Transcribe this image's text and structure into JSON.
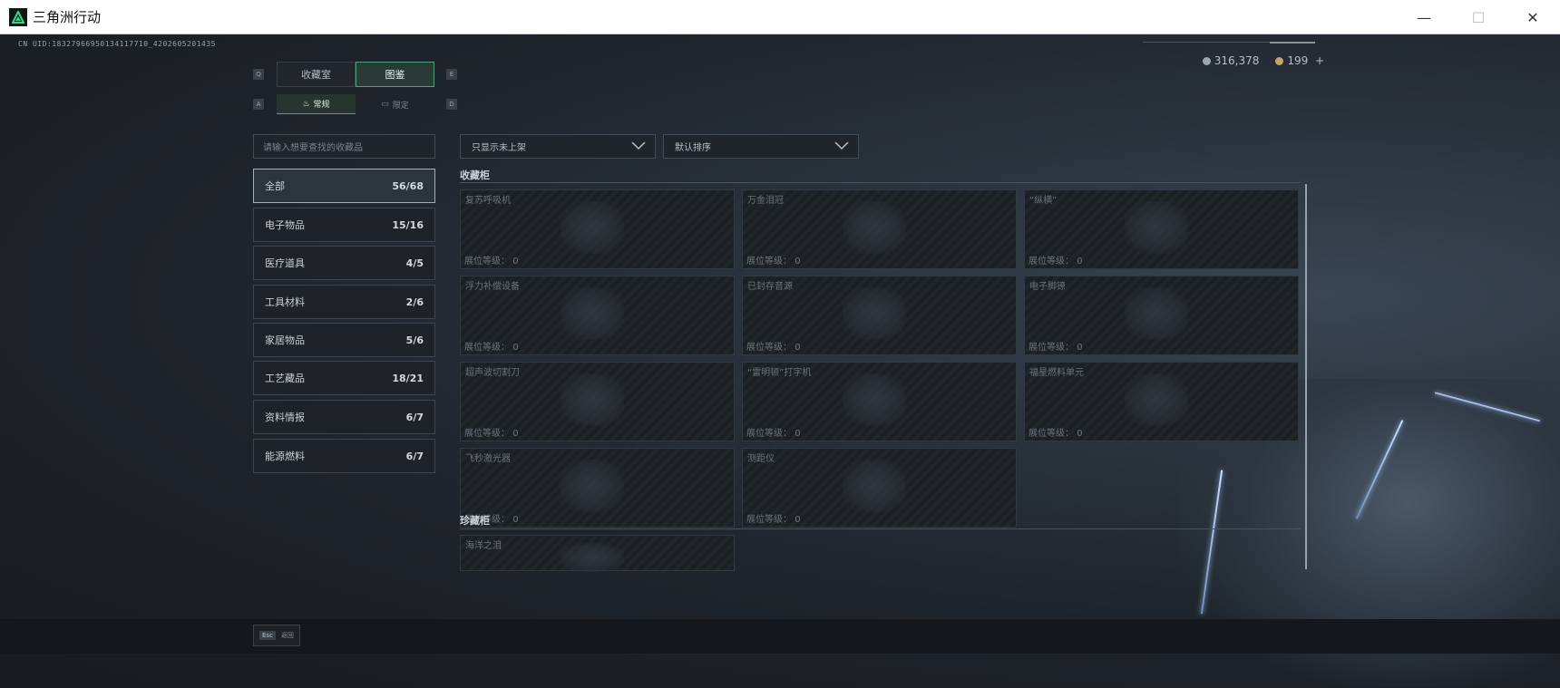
{
  "window": {
    "title": "三角洲行动",
    "minimize": "—",
    "maximize": "☐",
    "close": "✕"
  },
  "uid": "CN UID:18327966950134117710_4202605201435",
  "currency": {
    "silver": "316,378",
    "gold": "199",
    "add": "+"
  },
  "tabs": {
    "left_key": "Q",
    "right_key": "E",
    "items": [
      {
        "label": "收藏室",
        "active": false
      },
      {
        "label": "图鉴",
        "active": true
      }
    ]
  },
  "subtabs": {
    "left_key": "A",
    "right_key": "D",
    "items": [
      {
        "label": "常规",
        "icon": "flame-icon",
        "active": true
      },
      {
        "label": "限定",
        "icon": "ticket-icon",
        "active": false
      }
    ]
  },
  "search": {
    "placeholder": "请输入想要查找的收藏品"
  },
  "filters": {
    "show_filter": "只显示未上架",
    "sort": "默认排序"
  },
  "categories": [
    {
      "label": "全部",
      "count": "56/68",
      "active": true
    },
    {
      "label": "电子物品",
      "count": "15/16",
      "active": false
    },
    {
      "label": "医疗道具",
      "count": "4/5",
      "active": false
    },
    {
      "label": "工具材料",
      "count": "2/6",
      "active": false
    },
    {
      "label": "家居物品",
      "count": "5/6",
      "active": false
    },
    {
      "label": "工艺藏品",
      "count": "18/21",
      "active": false
    },
    {
      "label": "资料情报",
      "count": "6/7",
      "active": false
    },
    {
      "label": "能源燃料",
      "count": "6/7",
      "active": false
    }
  ],
  "sections": {
    "cabinet_title": "收藏柜",
    "treasure_title": "珍藏柜"
  },
  "level_label": "展位等级：",
  "cabinet_items": [
    {
      "name": "复苏呼吸机",
      "level": "0"
    },
    {
      "name": "万金泪冠",
      "level": "0"
    },
    {
      "name": "“纵横”",
      "level": "0"
    },
    {
      "name": "浮力补偿设备",
      "level": "0"
    },
    {
      "name": "已封存音源",
      "level": "0"
    },
    {
      "name": "电子脚镣",
      "level": "0"
    },
    {
      "name": "超声波切割刀",
      "level": "0"
    },
    {
      "name": "“雷明顿”打字机",
      "level": "0"
    },
    {
      "name": "福星燃料单元",
      "level": "0"
    },
    {
      "name": "飞秒激光器",
      "level": "0"
    },
    {
      "name": "测距仪",
      "level": "0"
    }
  ],
  "treasure_items": [
    {
      "name": "海洋之泪"
    }
  ],
  "bottom": {
    "esc_key": "Esc",
    "back_label": "返回"
  },
  "colors": {
    "accent": "#4fa07d",
    "background": "#1a1f25"
  }
}
